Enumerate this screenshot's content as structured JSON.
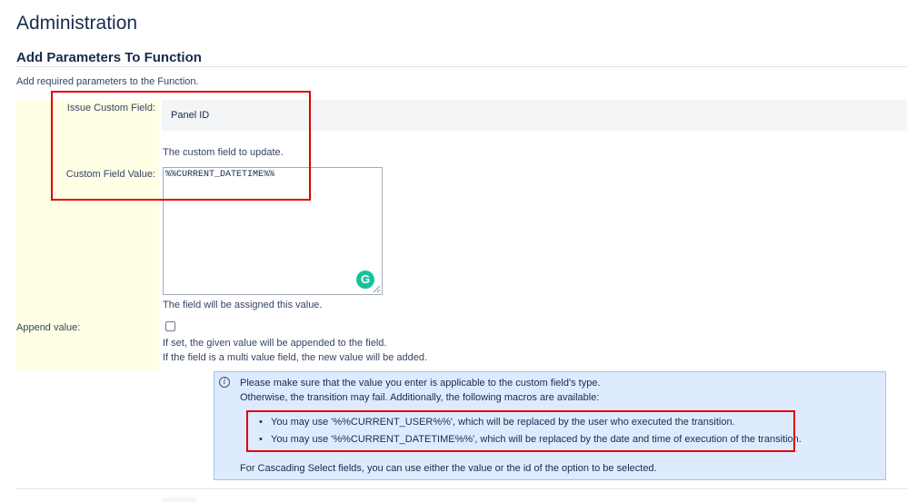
{
  "page": {
    "title": "Administration",
    "section_title": "Add Parameters To Function",
    "intro": "Add required parameters to the Function."
  },
  "form": {
    "issue_custom_field": {
      "label": "Issue Custom Field:",
      "selected_value": "Panel ID",
      "description": "The custom field to update."
    },
    "custom_field_value": {
      "label": "Custom Field Value:",
      "value": "%%CURRENT_DATETIME%%",
      "description": "The field will be assigned this value."
    },
    "append_value": {
      "label": "Append value:",
      "checked": false,
      "description_line1": "If set, the given value will be appended to the field.",
      "description_line2": "If the field is a multi value field, the new value will be added."
    }
  },
  "info": {
    "icon": "info-icon",
    "line1": "Please make sure that the value you enter is applicable to the custom field's type.",
    "line2": "Otherwise, the transition may fail. Additionally, the following macros are available:",
    "macros": [
      "You may use '%%CURRENT_USER%%', which will be replaced by the user who executed the transition.",
      "You may use '%%CURRENT_DATETIME%%', which will be replaced by the date and time of execution of the transition."
    ],
    "line3": "For Cascading Select fields, you can use either the value or the id of the option to be selected."
  },
  "colors": {
    "annotation": "#e00000",
    "label_column": "#ffffe6",
    "info_panel": "#deebff",
    "grammarly": "#15c39a"
  }
}
